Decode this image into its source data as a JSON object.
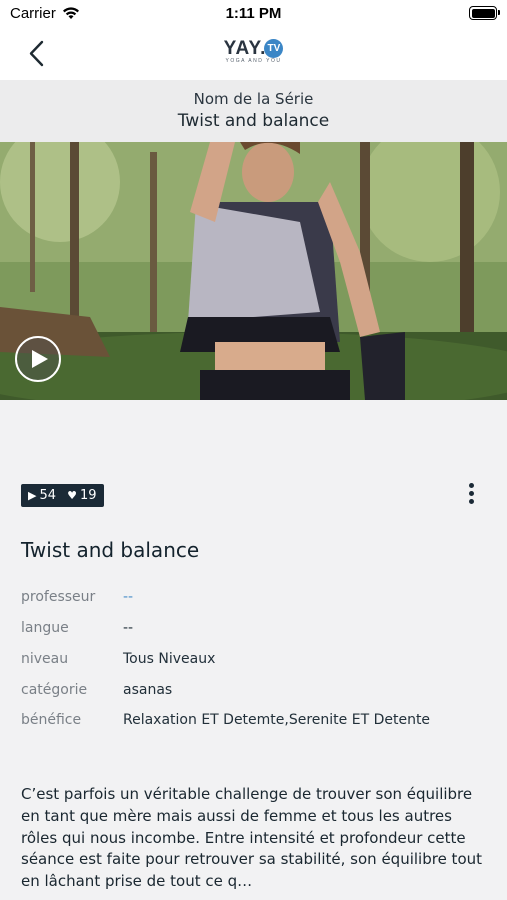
{
  "status_bar": {
    "carrier": "Carrier",
    "time": "1:11 PM"
  },
  "nav": {
    "logo_text": "YAY.",
    "logo_badge": "TV",
    "logo_tagline": "YOGA AND YOU"
  },
  "series": {
    "label": "Nom de la Série",
    "name": "Twist and balance"
  },
  "stats": {
    "views": "54",
    "likes": "19"
  },
  "video": {
    "title": "Twist and balance"
  },
  "meta": {
    "professeur": {
      "label": "professeur",
      "value": "--"
    },
    "langue": {
      "label": "langue",
      "value": "--"
    },
    "niveau": {
      "label": "niveau",
      "value": "Tous Niveaux"
    },
    "categorie": {
      "label": "catégorie",
      "value": "asanas"
    },
    "benefice": {
      "label": "bénéfice",
      "value": "Relaxation ET Detemte,Serenite ET Detente"
    }
  },
  "description": "C’est parfois un véritable challenge de trouver son équilibre en tant que mère mais aussi de femme et tous les autres rôles qui nous incombe. Entre intensité et profondeur cette séance est faite pour retrouver sa stabilité, son équilibre tout en lâchant prise de tout ce q…",
  "colors": {
    "accent": "#3b86c6",
    "badge_bg": "#1b2a36",
    "link": "#4a8fc8"
  },
  "icons": {
    "back": "chevron-left-icon",
    "play": "play-icon",
    "views": "play-small-icon",
    "likes": "heart-icon",
    "more": "more-vertical-icon"
  }
}
